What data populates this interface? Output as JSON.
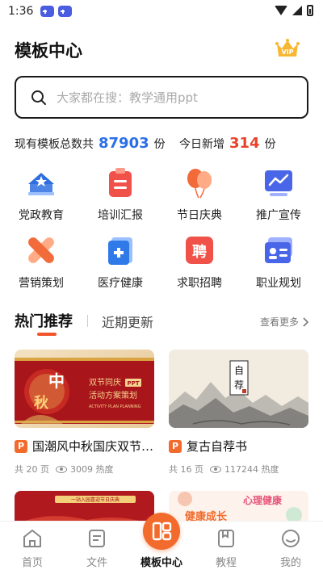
{
  "status_bar": {
    "time": "1:36"
  },
  "header": {
    "title": "模板中心",
    "vip_label": "VIP"
  },
  "search": {
    "placeholder": "大家都在搜：教学通用ppt"
  },
  "stats": {
    "total_label": "现有模板总数共",
    "total_value": "87903",
    "total_unit": "份",
    "today_label": "今日新增",
    "today_value": "314",
    "today_unit": "份"
  },
  "categories": [
    {
      "label": "党政教育",
      "icon": "party-icon",
      "color": "#2f6ee0"
    },
    {
      "label": "培训汇报",
      "icon": "clipboard-icon",
      "color": "#f0524a"
    },
    {
      "label": "节日庆典",
      "icon": "balloons-icon",
      "color": "#f2693a"
    },
    {
      "label": "推广宣传",
      "icon": "chart-screen-icon",
      "color": "#4a66e8"
    },
    {
      "label": "营销策划",
      "icon": "bandage-icon",
      "color": "#f26b3a"
    },
    {
      "label": "医疗健康",
      "icon": "medical-icon",
      "color": "#2f7ae8"
    },
    {
      "label": "求职招聘",
      "icon": "hire-icon",
      "color": "#f0524a"
    },
    {
      "label": "职业规划",
      "icon": "id-card-icon",
      "color": "#4a66e8"
    }
  ],
  "tabs": {
    "hot": "热门推荐",
    "recent": "近期更新",
    "see_more": "查看更多"
  },
  "cards": [
    {
      "badge": "P",
      "title": "国潮风中秋国庆双节活动方案策划",
      "pages": "共 20 页",
      "heat": "3009 热度",
      "thumb": {
        "char1": "中",
        "char2": "秋",
        "line1": "双节同庆",
        "ppt": "PPT",
        "line2": "活动方案策划",
        "line3": "ACTIVITY PLAN PLANNING"
      }
    },
    {
      "badge": "P",
      "title": "复古自荐书",
      "pages": "共 16 页",
      "heat": "117244 热度",
      "thumb": {
        "seal1": "自",
        "seal2": "荐"
      }
    }
  ],
  "partial_cards": [
    {
      "text": "一站入园喜迎节日庆典"
    },
    {
      "line1": "心理健康",
      "line2": "健康成长"
    }
  ],
  "bottom_nav": [
    {
      "label": "首页",
      "icon": "home-icon"
    },
    {
      "label": "文件",
      "icon": "file-icon"
    },
    {
      "label": "模板中心",
      "icon": "template-icon",
      "active": true
    },
    {
      "label": "教程",
      "icon": "tutorial-icon"
    },
    {
      "label": "我的",
      "icon": "profile-icon"
    }
  ],
  "colors": {
    "accent": "#f26b2d",
    "blue": "#2b6fe8",
    "red": "#e8422a"
  }
}
